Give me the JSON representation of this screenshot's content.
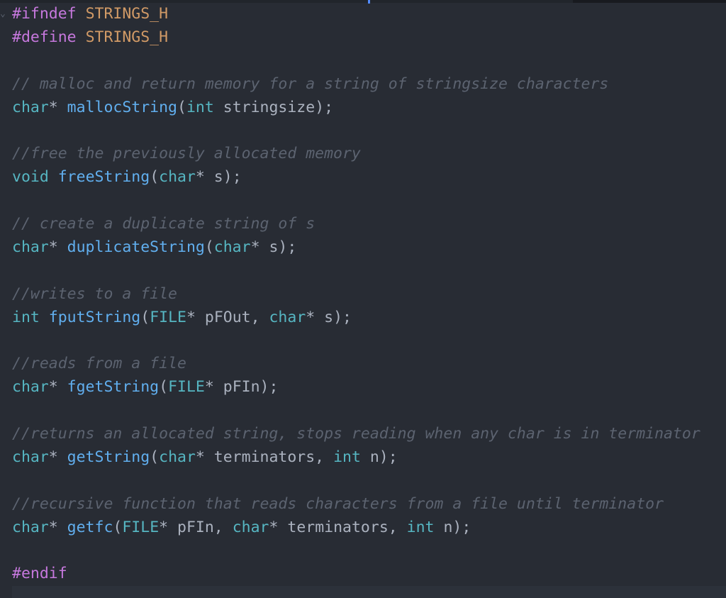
{
  "editor": {
    "fold_marker": "⌄",
    "lines": [
      [
        {
          "t": "#ifndef ",
          "c": "pp"
        },
        {
          "t": "STRINGS_H",
          "c": "macro"
        }
      ],
      [
        {
          "t": "#define ",
          "c": "pp"
        },
        {
          "t": "STRINGS_H",
          "c": "macro"
        }
      ],
      [],
      [
        {
          "t": "// malloc and return memory for a string of stringsize characters",
          "c": "cm"
        }
      ],
      [
        {
          "t": "char",
          "c": "type"
        },
        {
          "t": "* ",
          "c": "plain"
        },
        {
          "t": "mallocString",
          "c": "fn"
        },
        {
          "t": "(",
          "c": "plain"
        },
        {
          "t": "int",
          "c": "type"
        },
        {
          "t": " stringsize);",
          "c": "plain"
        }
      ],
      [],
      [
        {
          "t": "//free the previously allocated memory",
          "c": "cm"
        }
      ],
      [
        {
          "t": "void",
          "c": "type"
        },
        {
          "t": " ",
          "c": "plain"
        },
        {
          "t": "freeString",
          "c": "fn"
        },
        {
          "t": "(",
          "c": "plain"
        },
        {
          "t": "char",
          "c": "type"
        },
        {
          "t": "* s);",
          "c": "plain"
        }
      ],
      [],
      [
        {
          "t": "// create a duplicate string of s",
          "c": "cm"
        }
      ],
      [
        {
          "t": "char",
          "c": "type"
        },
        {
          "t": "* ",
          "c": "plain"
        },
        {
          "t": "duplicateString",
          "c": "fn"
        },
        {
          "t": "(",
          "c": "plain"
        },
        {
          "t": "char",
          "c": "type"
        },
        {
          "t": "* s);",
          "c": "plain"
        }
      ],
      [],
      [
        {
          "t": "//writes to a file",
          "c": "cm"
        }
      ],
      [
        {
          "t": "int",
          "c": "type"
        },
        {
          "t": " ",
          "c": "plain"
        },
        {
          "t": "fputString",
          "c": "fn"
        },
        {
          "t": "(",
          "c": "plain"
        },
        {
          "t": "FILE",
          "c": "type"
        },
        {
          "t": "* pFOut, ",
          "c": "plain"
        },
        {
          "t": "char",
          "c": "type"
        },
        {
          "t": "* s);",
          "c": "plain"
        }
      ],
      [],
      [
        {
          "t": "//reads from a file",
          "c": "cm"
        }
      ],
      [
        {
          "t": "char",
          "c": "type"
        },
        {
          "t": "* ",
          "c": "plain"
        },
        {
          "t": "fgetString",
          "c": "fn"
        },
        {
          "t": "(",
          "c": "plain"
        },
        {
          "t": "FILE",
          "c": "type"
        },
        {
          "t": "* pFIn);",
          "c": "plain"
        }
      ],
      [],
      [
        {
          "t": "//returns an allocated string, stops reading when any char is in terminator",
          "c": "cm"
        }
      ],
      [
        {
          "t": "char",
          "c": "type"
        },
        {
          "t": "* ",
          "c": "plain"
        },
        {
          "t": "getString",
          "c": "fn"
        },
        {
          "t": "(",
          "c": "plain"
        },
        {
          "t": "char",
          "c": "type"
        },
        {
          "t": "* terminators, ",
          "c": "plain"
        },
        {
          "t": "int",
          "c": "type"
        },
        {
          "t": " n);",
          "c": "plain"
        }
      ],
      [],
      [
        {
          "t": "//recursive function that reads characters from a file until terminator",
          "c": "cm"
        }
      ],
      [
        {
          "t": "char",
          "c": "type"
        },
        {
          "t": "* ",
          "c": "plain"
        },
        {
          "t": "getfc",
          "c": "fn"
        },
        {
          "t": "(",
          "c": "plain"
        },
        {
          "t": "FILE",
          "c": "type"
        },
        {
          "t": "* pFIn, ",
          "c": "plain"
        },
        {
          "t": "char",
          "c": "type"
        },
        {
          "t": "* terminators, ",
          "c": "plain"
        },
        {
          "t": "int",
          "c": "type"
        },
        {
          "t": " n);",
          "c": "plain"
        }
      ],
      [],
      [
        {
          "t": "#endif",
          "c": "pp"
        }
      ]
    ]
  },
  "colors": {
    "background": "#282c34",
    "preprocessor": "#c678dd",
    "macro": "#d19a66",
    "type": "#56b6c2",
    "function": "#61afef",
    "comment": "#5c6370",
    "plain": "#abb2bf"
  }
}
